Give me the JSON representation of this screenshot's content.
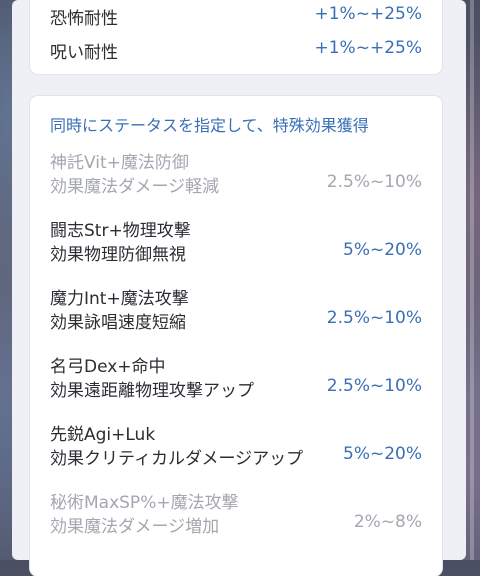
{
  "resistances": [
    {
      "label": "恐怖耐性",
      "value": "+1%~+25%"
    },
    {
      "label": "呪い耐性",
      "value": "+1%~+25%"
    }
  ],
  "special": {
    "heading": "同時にステータスを指定して、特殊効果獲得",
    "items": [
      {
        "line1": "神託Vit+魔法防御",
        "line2": "効果魔法ダメージ軽減",
        "value": "2.5%~10%",
        "dim": true
      },
      {
        "line1": "闘志Str+物理攻撃",
        "line2": "効果物理防御無視",
        "value": "5%~20%",
        "dim": false
      },
      {
        "line1": "魔力Int+魔法攻撃",
        "line2": "効果詠唱速度短縮",
        "value": "2.5%~10%",
        "dim": false
      },
      {
        "line1": "名弓Dex+命中",
        "line2": "効果遠距離物理攻撃アップ",
        "value": "2.5%~10%",
        "dim": false
      },
      {
        "line1": "先鋭Agi+Luk",
        "line2": "効果クリティカルダメージアップ",
        "value": "5%~20%",
        "dim": false
      },
      {
        "line1": "秘術MaxSP%+魔法攻撃",
        "line2": "効果魔法ダメージ増加",
        "value": "2%~8%",
        "dim": true
      }
    ]
  }
}
